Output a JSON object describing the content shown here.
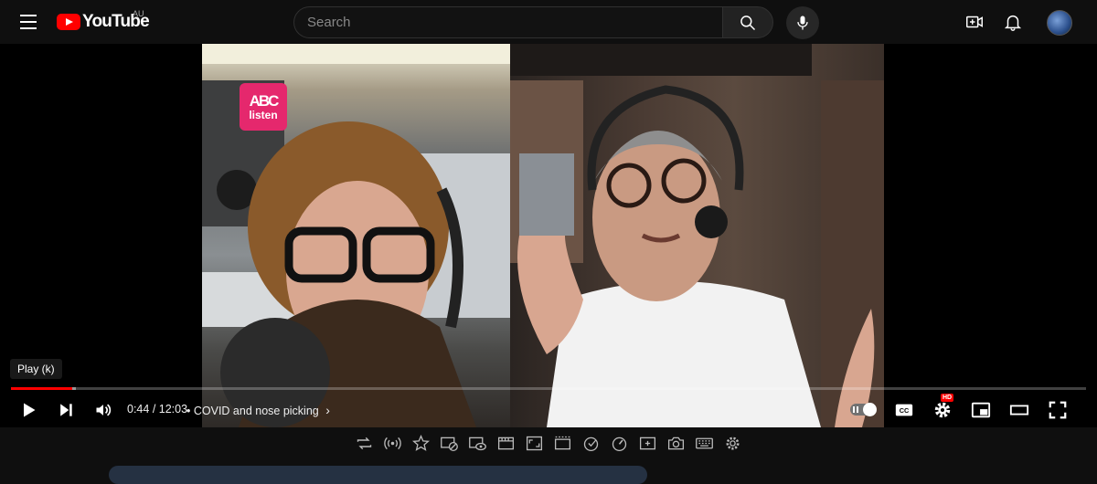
{
  "header": {
    "logo_text": "YouTube",
    "region": "AU",
    "search_placeholder": "Search"
  },
  "player": {
    "video_badge_symbol": "ABC",
    "video_badge_text": "listen",
    "tooltip": "Play (k)",
    "current_time": "0:44",
    "duration": "12:03",
    "time_separator": " / ",
    "chapter": "COVID and nose picking",
    "progress_played_fraction": 0.057,
    "progress_loaded_fraction": 0.06,
    "hd_badge": "HD"
  },
  "extension_toolbar": {
    "icons": [
      "loop-icon",
      "radio-icon",
      "star-icon",
      "ad-block-icon",
      "hide-eye-icon",
      "filmstrip-icon",
      "aspect-icon",
      "window-icon",
      "heart-icon",
      "speed-icon",
      "screenshot-plus-icon",
      "camera-icon",
      "keyboard-icon",
      "settings-gear-icon"
    ]
  },
  "colors": {
    "brand_red": "#ff0000",
    "abc_pink": "#e5286d",
    "background": "#0f0f0f"
  }
}
